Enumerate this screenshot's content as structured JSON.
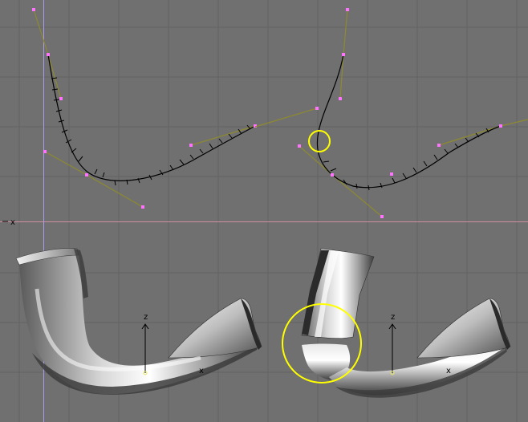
{
  "viewport": {
    "background": "#707070",
    "grid_color": "#616161",
    "x_axis_color": "#cf8fa0",
    "y_axis_color": "#9a92d8"
  },
  "colors": {
    "curve": "#000000",
    "handle_line": "#8d8a2f",
    "control_point": "#ff74ff",
    "highlight": "#ffff00",
    "mesh_light": "#f0f0f0",
    "mesh_dark": "#4a4a4a"
  },
  "axes": {
    "origin_x_label": "x",
    "pipe_left_z_label": "z",
    "pipe_left_x_label": "x",
    "pipe_right_z_label": "z",
    "pipe_right_x_label": "x"
  },
  "icons": {
    "circle_highlight": "highlight-circle-icon",
    "axis_gizmo": "axis-gizmo-icon"
  }
}
